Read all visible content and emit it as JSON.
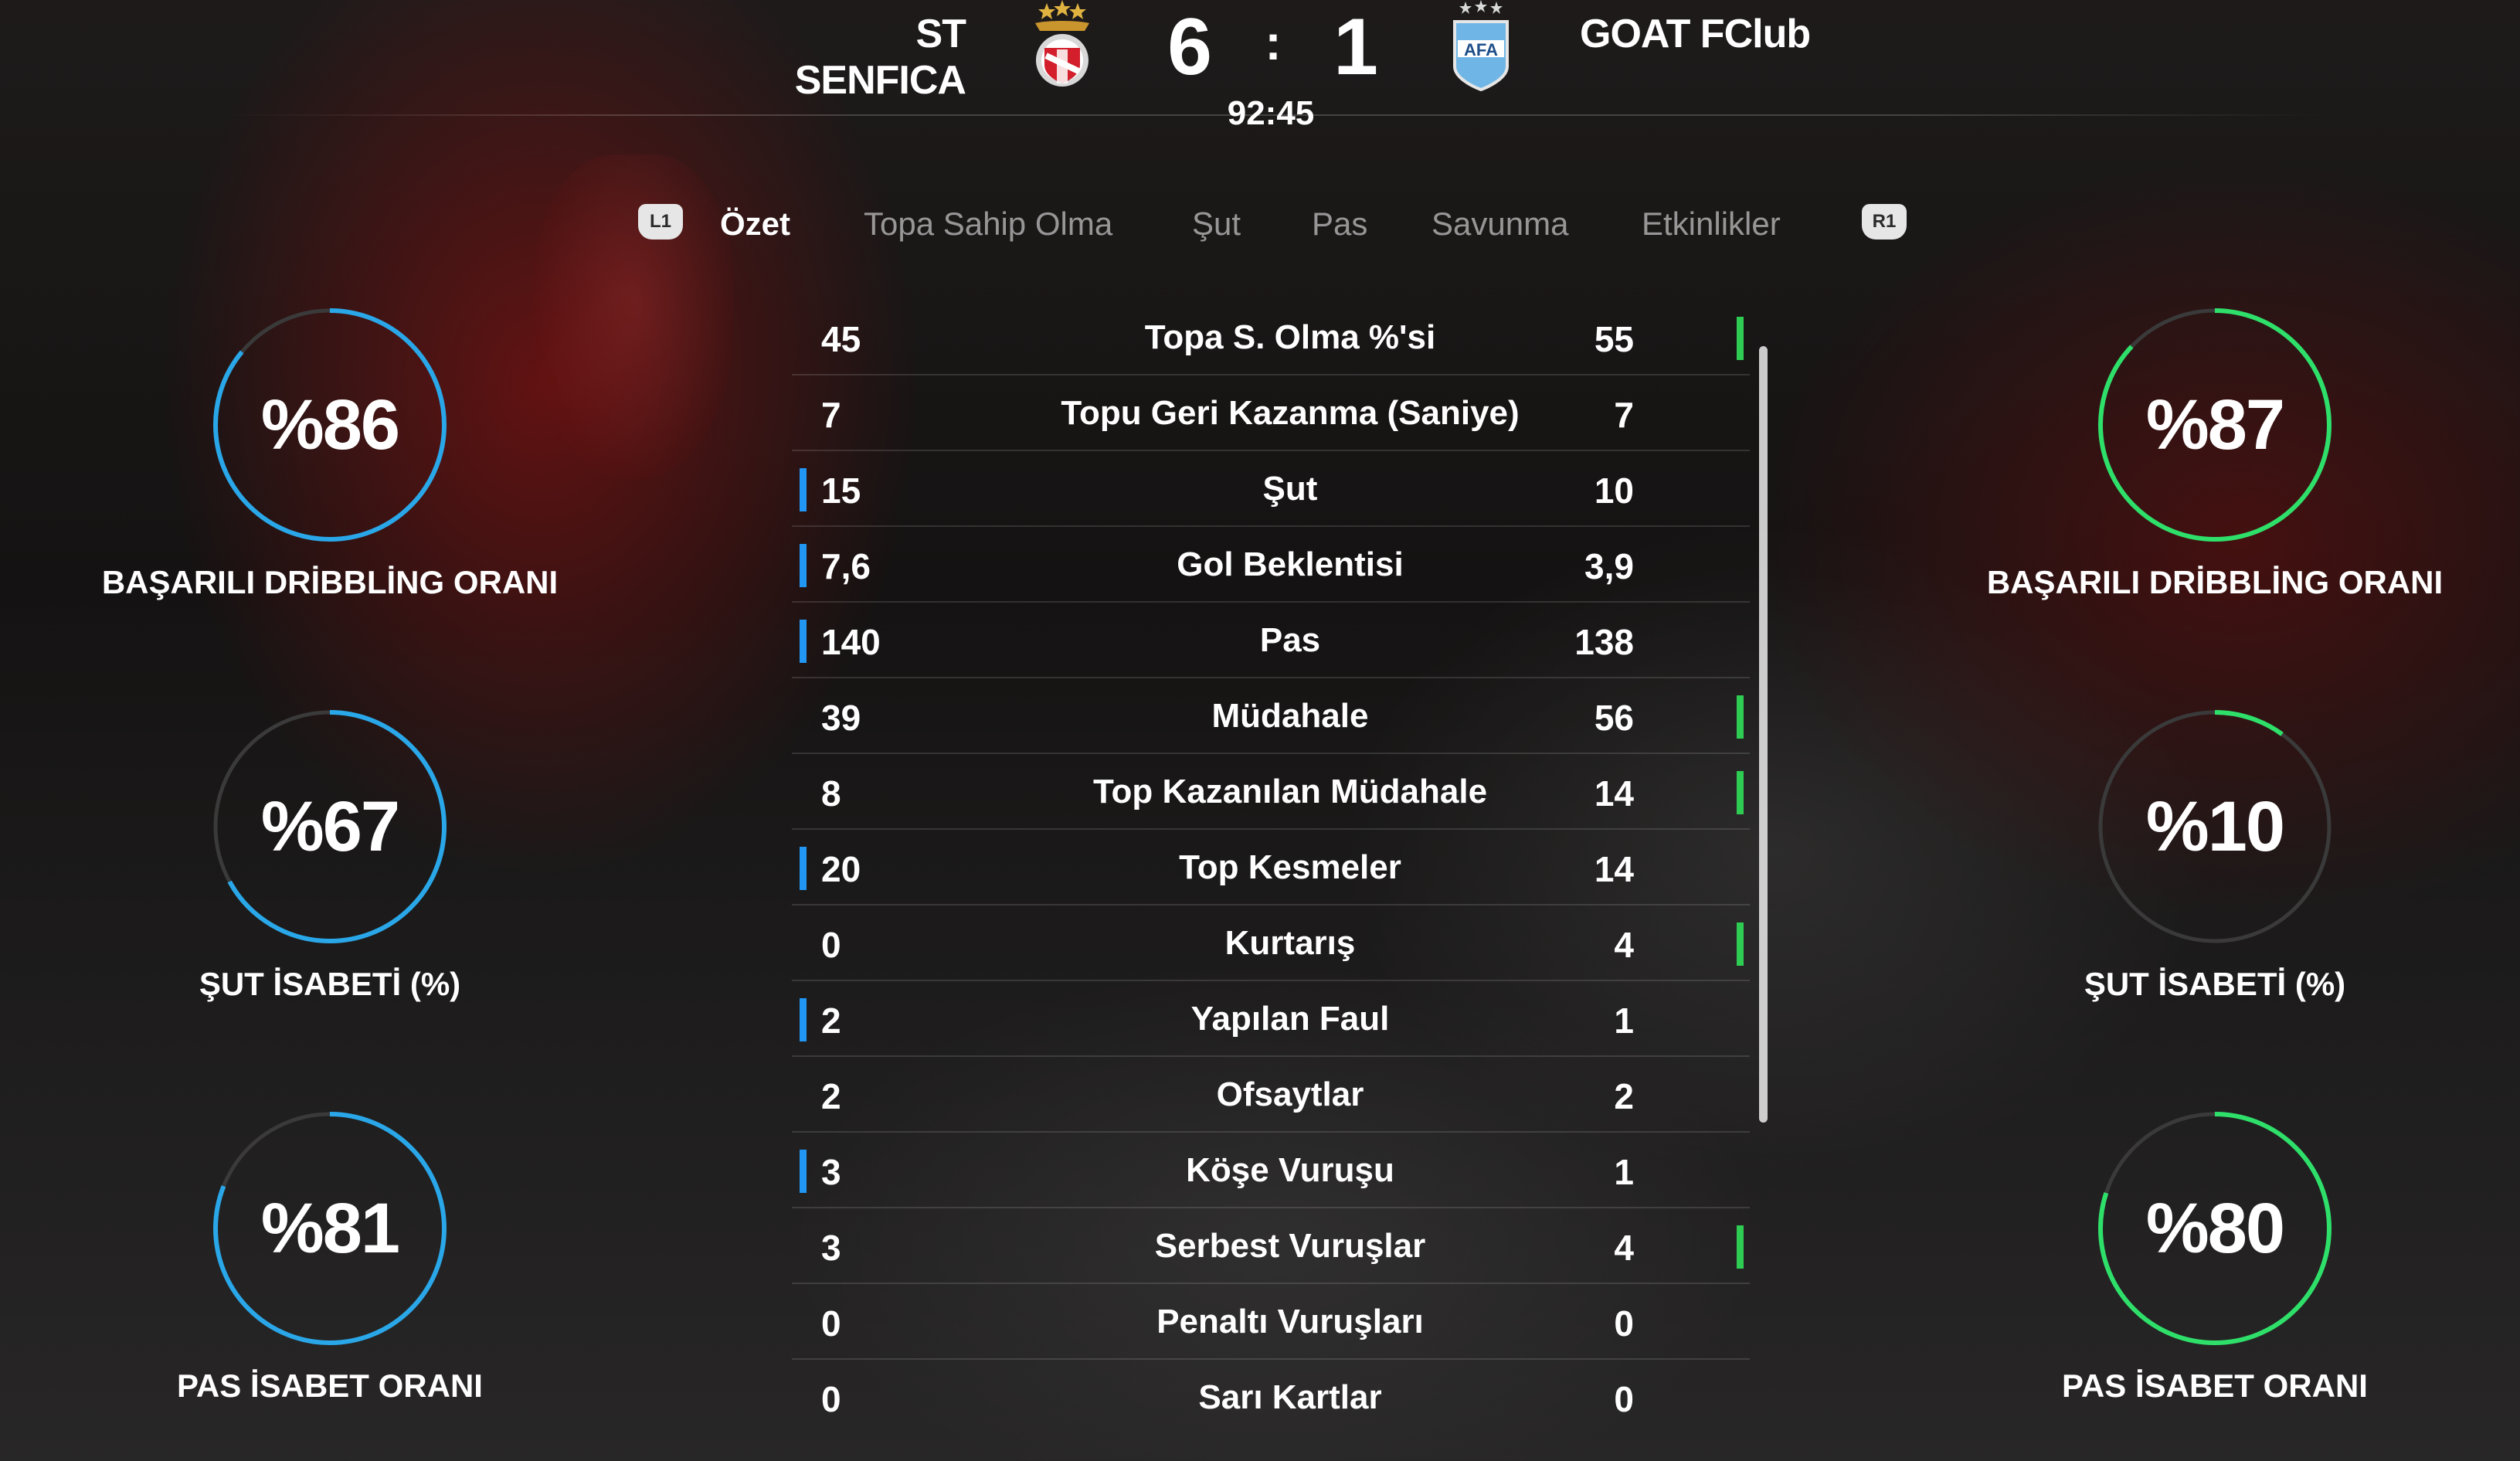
{
  "match": {
    "home_team": "ST SENFICA",
    "away_team": "GOAT FClub",
    "home_score": "6",
    "separator": ":",
    "away_score": "1",
    "clock": "92:45",
    "home_crest_icon": "benfica-crest-icon",
    "away_crest_icon": "argentina-crest-icon"
  },
  "tabs": {
    "left_hint": "L1",
    "right_hint": "R1",
    "items": [
      {
        "label": "Özet",
        "active": true
      },
      {
        "label": "Topa Sahip Olma",
        "active": false
      },
      {
        "label": "Şut",
        "active": false
      },
      {
        "label": "Pas",
        "active": false
      },
      {
        "label": "Savunma",
        "active": false
      },
      {
        "label": "Etkinlikler",
        "active": false
      }
    ]
  },
  "stats": [
    {
      "left": "45",
      "name": "Topa S. Olma %'si",
      "right": "55",
      "lead": "right"
    },
    {
      "left": "7",
      "name": "Topu Geri Kazanma (Saniye)",
      "right": "7",
      "lead": "none"
    },
    {
      "left": "15",
      "name": "Şut",
      "right": "10",
      "lead": "left"
    },
    {
      "left": "7,6",
      "name": "Gol Beklentisi",
      "right": "3,9",
      "lead": "left"
    },
    {
      "left": "140",
      "name": "Pas",
      "right": "138",
      "lead": "left"
    },
    {
      "left": "39",
      "name": "Müdahale",
      "right": "56",
      "lead": "right"
    },
    {
      "left": "8",
      "name": "Top Kazanılan Müdahale",
      "right": "14",
      "lead": "right"
    },
    {
      "left": "20",
      "name": "Top Kesmeler",
      "right": "14",
      "lead": "left"
    },
    {
      "left": "0",
      "name": "Kurtarış",
      "right": "4",
      "lead": "right"
    },
    {
      "left": "2",
      "name": "Yapılan Faul",
      "right": "1",
      "lead": "left"
    },
    {
      "left": "2",
      "name": "Ofsaytlar",
      "right": "2",
      "lead": "none"
    },
    {
      "left": "3",
      "name": "Köşe Vuruşu",
      "right": "1",
      "lead": "left"
    },
    {
      "left": "3",
      "name": "Serbest Vuruşlar",
      "right": "4",
      "lead": "right"
    },
    {
      "left": "0",
      "name": "Penaltı Vuruşları",
      "right": "0",
      "lead": "none"
    },
    {
      "left": "0",
      "name": "Sarı Kartlar",
      "right": "0",
      "lead": "none"
    }
  ],
  "gauges": {
    "home": [
      {
        "text": "%86",
        "value": 86,
        "label": "BAŞARILI DRİBBLİNG ORANI"
      },
      {
        "text": "%67",
        "value": 67,
        "label": "ŞUT İSABETİ (%)"
      },
      {
        "text": "%81",
        "value": 81,
        "label": "PAS İSABET ORANI"
      }
    ],
    "away": [
      {
        "text": "%87",
        "value": 87,
        "label": "BAŞARILI DRİBBLİNG ORANI"
      },
      {
        "text": "%10",
        "value": 10,
        "label": "ŞUT İSABETİ (%)"
      },
      {
        "text": "%80",
        "value": 80,
        "label": "PAS İSABET ORANI"
      }
    ]
  },
  "colors": {
    "home_accent": "#2aa7e8",
    "away_accent": "#2ee06a",
    "track": "#3a3a3a",
    "home_marker": "#2196f3",
    "away_marker": "#2ecc52"
  }
}
